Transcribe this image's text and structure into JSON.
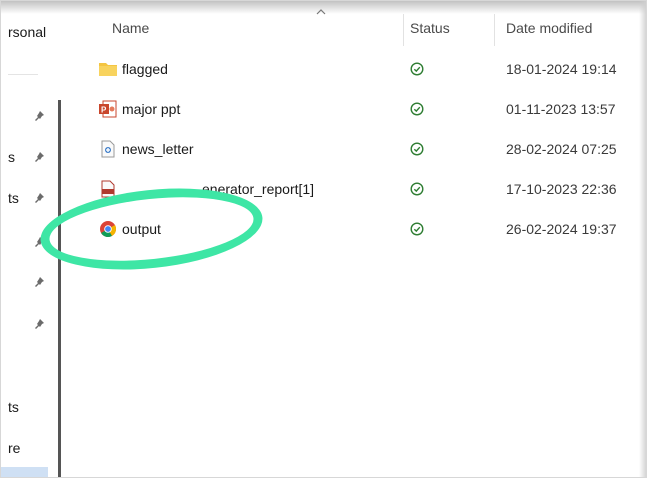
{
  "sidebar": {
    "items": [
      {
        "label": "rsonal"
      },
      {
        "label": "s"
      },
      {
        "label": "ts"
      },
      {
        "label": "ts"
      },
      {
        "label": "re"
      }
    ]
  },
  "columns": {
    "name": "Name",
    "status": "Status",
    "date_modified": "Date modified"
  },
  "files": [
    {
      "name": "flagged",
      "icon": "folder-icon",
      "status": "synced",
      "date": "18-01-2024 19:14"
    },
    {
      "name": "major ppt",
      "icon": "powerpoint-icon",
      "status": "synced",
      "date": "01-11-2023 13:57"
    },
    {
      "name": "news_letter",
      "icon": "document-icon",
      "status": "synced",
      "date": "28-02-2024 07:25"
    },
    {
      "name": "enerator_report[1]",
      "icon": "pdf-icon",
      "status": "synced",
      "date": "17-10-2023 22:36"
    },
    {
      "name": "output",
      "icon": "chrome-icon",
      "status": "synced",
      "date": "26-02-2024 19:37"
    }
  ],
  "colors": {
    "annotation": "#3ee6a5",
    "status_ok": "#2e7d32",
    "folder": "#f4c542",
    "powerpoint": "#c9462c",
    "selection": "#cfe0f4"
  }
}
